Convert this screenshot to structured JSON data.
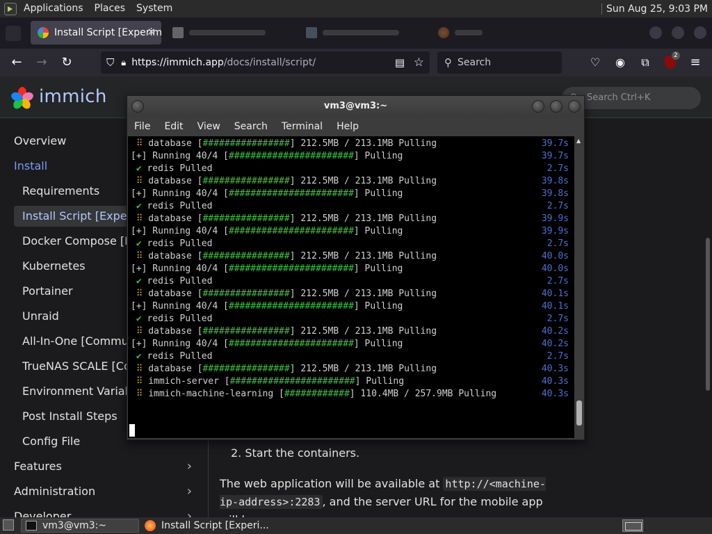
{
  "panel": {
    "menus": [
      "Applications",
      "Places",
      "System"
    ],
    "clock": "Sun Aug 25,  9:03 PM"
  },
  "browser": {
    "tabs": [
      {
        "label": "Install Script [Experim",
        "active": true
      },
      {
        "label": "",
        "active": false
      },
      {
        "label": "",
        "active": false
      },
      {
        "label": "",
        "active": false
      }
    ],
    "url_domain": "https://immich.app",
    "url_path": "/docs/install/script/",
    "search_placeholder": "Search",
    "extension_badge": "2"
  },
  "site": {
    "logo_text": "immich",
    "search_placeholder": "Search Ctrl+K"
  },
  "sidebar": {
    "overview": "Overview",
    "install": "Install",
    "items": [
      "Requirements",
      "Install Script [Experimental]",
      "Docker Compose [Recommended]",
      "Kubernetes",
      "Portainer",
      "Unraid",
      "All-In-One [Community]",
      "TrueNAS SCALE [Community]",
      "Environment Variables",
      "Post Install Steps",
      "Config File"
    ],
    "features": "Features",
    "administration": "Administration",
    "developer": "Developer"
  },
  "content": {
    "step": "2. Start the containers.",
    "para_a": "The web application will be available at ",
    "para_code1": "http://<machine-ip-address>:2283",
    "para_b": ", and the server URL for the mobile app will be"
  },
  "terminal": {
    "title": "vm3@vm3:~",
    "menu": [
      "File",
      "Edit",
      "View",
      "Search",
      "Terminal",
      "Help"
    ],
    "lines": [
      {
        "kind": "db",
        "text": "database [################] 212.5MB / 213.1MB Pulling",
        "time": "39.7s"
      },
      {
        "kind": "run",
        "text": "[+] Running 40/4 [#######################] Pulling",
        "time": "39.7s"
      },
      {
        "kind": "ok",
        "text": "redis Pulled",
        "time": "2.7s"
      },
      {
        "kind": "db",
        "text": "database [################] 212.5MB / 213.1MB Pulling",
        "time": "39.8s"
      },
      {
        "kind": "run",
        "text": "[+] Running 40/4 [#######################] Pulling",
        "time": "39.8s"
      },
      {
        "kind": "ok",
        "text": "redis Pulled",
        "time": "2.7s"
      },
      {
        "kind": "db",
        "text": "database [################] 212.5MB / 213.1MB Pulling",
        "time": "39.9s"
      },
      {
        "kind": "run",
        "text": "[+] Running 40/4 [#######################] Pulling",
        "time": "39.9s"
      },
      {
        "kind": "ok",
        "text": "redis Pulled",
        "time": "2.7s"
      },
      {
        "kind": "db",
        "text": "database [################] 212.5MB / 213.1MB Pulling",
        "time": "40.0s"
      },
      {
        "kind": "run",
        "text": "[+] Running 40/4 [#######################] Pulling",
        "time": "40.0s"
      },
      {
        "kind": "ok",
        "text": "redis Pulled",
        "time": "2.7s"
      },
      {
        "kind": "db",
        "text": "database [################] 212.5MB / 213.1MB Pulling",
        "time": "40.1s"
      },
      {
        "kind": "run",
        "text": "[+] Running 40/4 [#######################] Pulling",
        "time": "40.1s"
      },
      {
        "kind": "ok",
        "text": "redis Pulled",
        "time": "2.7s"
      },
      {
        "kind": "db",
        "text": "database [################] 212.5MB / 213.1MB Pulling",
        "time": "40.2s"
      },
      {
        "kind": "run",
        "text": "[+] Running 40/4 [#######################] Pulling",
        "time": "40.2s"
      },
      {
        "kind": "ok",
        "text": "redis Pulled",
        "time": "2.7s"
      },
      {
        "kind": "db",
        "text": "database [################] 212.5MB / 213.1MB Pulling",
        "time": "40.3s"
      },
      {
        "kind": "db",
        "text": "immich-server [#######################] Pulling",
        "time": "40.3s"
      },
      {
        "kind": "db",
        "text": "immich-machine-learning [############] 110.4MB / 257.9MB Pulling",
        "time": "40.3s"
      }
    ]
  },
  "taskbar": {
    "items": [
      "vm3@vm3:~",
      "Install Script [Experi..."
    ]
  },
  "colors": {
    "accent": "#b5c7ff",
    "link": "#7b9cf5",
    "terminal_ok": "#3fbf3f",
    "terminal_time": "#4f6fd1"
  }
}
